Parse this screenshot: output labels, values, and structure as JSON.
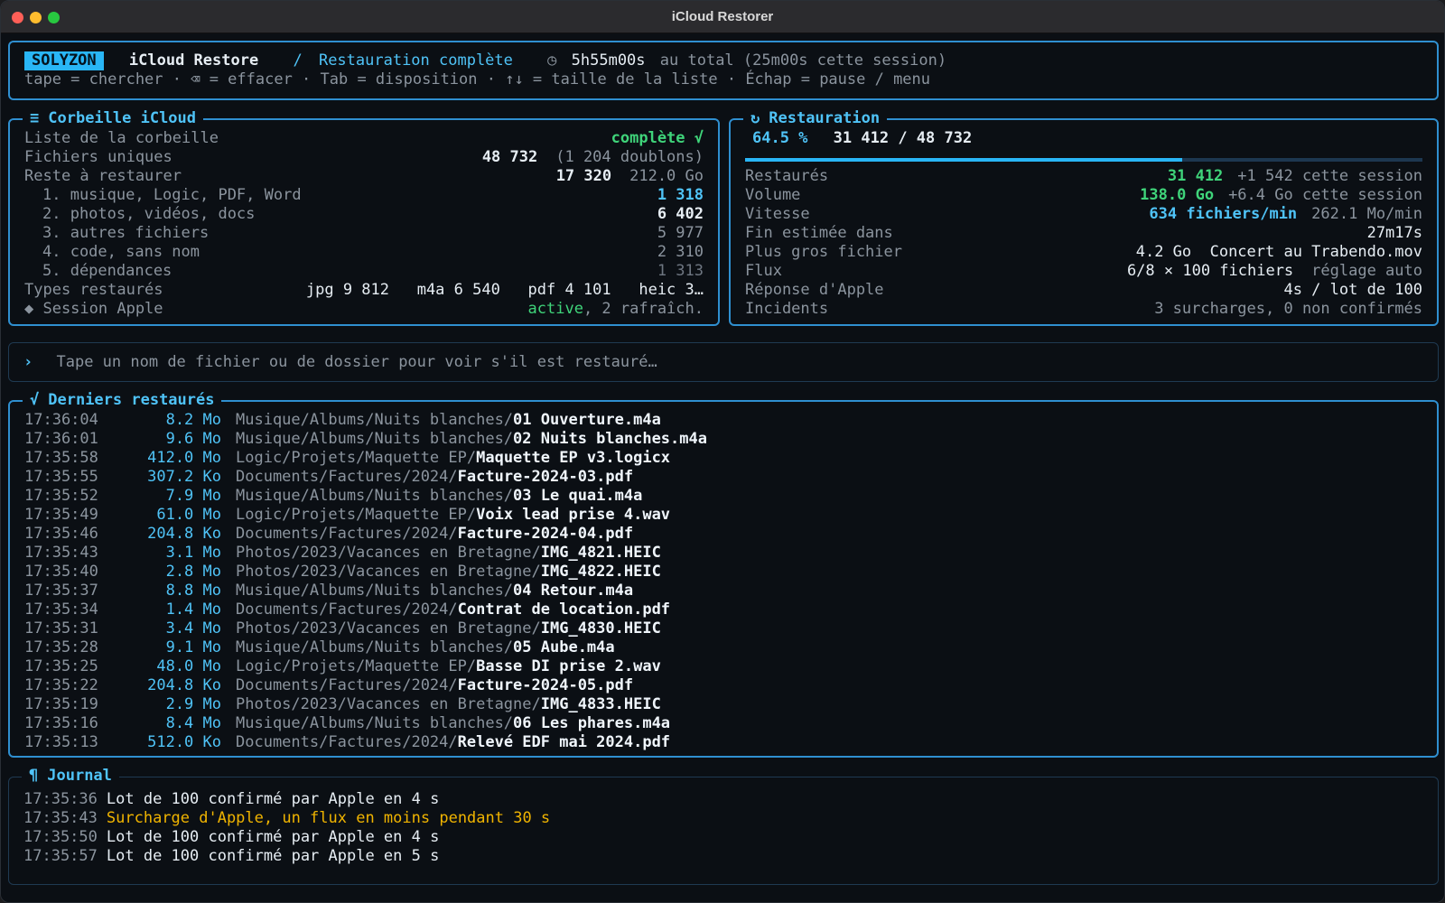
{
  "window": {
    "title": "iCloud Restorer"
  },
  "header": {
    "brand": "SOLYZON",
    "app": "iCloud Restore",
    "separator": "/",
    "mode": "Restauration complète",
    "clock_icon": "◷",
    "elapsed": "5h55m00s",
    "elapsed_suffix": "au total (25m00s cette session)",
    "hints": "tape = chercher · ⌫ = effacer · Tab = disposition · ↑↓ = taille de la liste · Échap = pause / menu"
  },
  "trash": {
    "title_icon": "≡",
    "title": "Corbeille iCloud",
    "rows": [
      {
        "label": "Liste de la corbeille",
        "value": "complète √"
      },
      {
        "label": "Fichiers uniques",
        "value": "48 732",
        "extra": "(1 204 doublons)"
      },
      {
        "label": "Reste à restaurer",
        "value": "17 320",
        "extra": "212.0 Go"
      },
      {
        "label": "1. musique, Logic, PDF, Word",
        "value": "1 318"
      },
      {
        "label": "2. photos, vidéos, docs",
        "value": "6 402"
      },
      {
        "label": "3. autres fichiers",
        "value": "5 977"
      },
      {
        "label": "4. code, sans nom",
        "value": "2 310"
      },
      {
        "label": "5. dépendances",
        "value": "1 313"
      },
      {
        "label": "Types restaurés",
        "value": "jpg 9 812   m4a 6 540   pdf 4 101   heic 3…"
      },
      {
        "label": "◆ Session Apple",
        "value_green": "active",
        "value_rest": ", 2 rafraîch."
      }
    ]
  },
  "restore": {
    "title_icon": "↻",
    "title": "Restauration",
    "percent": "64.5 %",
    "progress": 0.645,
    "count": "31 412 / 48 732",
    "rows": [
      {
        "label": "Restaurés",
        "value": "31 412",
        "extra": "+1 542 cette session"
      },
      {
        "label": "Volume",
        "value": "138.0 Go",
        "extra": "+6.4 Go cette session"
      },
      {
        "label": "Vitesse",
        "value": "634 fichiers/min",
        "extra": "262.1 Mo/min"
      },
      {
        "label": "Fin estimée dans",
        "value": "27m17s"
      },
      {
        "label": "Plus gros fichier",
        "value": "4.2 Go  Concert au Trabendo.mov"
      },
      {
        "label": "Flux",
        "value": "6/8 × 100 fichiers",
        "extra": "réglage auto"
      },
      {
        "label": "Réponse d'Apple",
        "value": "4s / lot de 100"
      },
      {
        "label": "Incidents",
        "value": "3 surcharges, 0 non confirmés"
      }
    ]
  },
  "search": {
    "prompt": "›",
    "placeholder": "Tape un nom de fichier ou de dossier pour voir s'il est restauré…"
  },
  "recent": {
    "title_icon": "√",
    "title": "Derniers restaurés",
    "items": [
      {
        "time": "17:36:04",
        "size": "8.2 Mo",
        "dir": "Musique/Albums/Nuits blanches/",
        "file": "01 Ouverture.m4a"
      },
      {
        "time": "17:36:01",
        "size": "9.6 Mo",
        "dir": "Musique/Albums/Nuits blanches/",
        "file": "02 Nuits blanches.m4a"
      },
      {
        "time": "17:35:58",
        "size": "412.0 Mo",
        "dir": "Logic/Projets/Maquette EP/",
        "file": "Maquette EP v3.logicx"
      },
      {
        "time": "17:35:55",
        "size": "307.2 Ko",
        "dir": "Documents/Factures/2024/",
        "file": "Facture-2024-03.pdf"
      },
      {
        "time": "17:35:52",
        "size": "7.9 Mo",
        "dir": "Musique/Albums/Nuits blanches/",
        "file": "03 Le quai.m4a"
      },
      {
        "time": "17:35:49",
        "size": "61.0 Mo",
        "dir": "Logic/Projets/Maquette EP/",
        "file": "Voix lead prise 4.wav"
      },
      {
        "time": "17:35:46",
        "size": "204.8 Ko",
        "dir": "Documents/Factures/2024/",
        "file": "Facture-2024-04.pdf"
      },
      {
        "time": "17:35:43",
        "size": "3.1 Mo",
        "dir": "Photos/2023/Vacances en Bretagne/",
        "file": "IMG_4821.HEIC"
      },
      {
        "time": "17:35:40",
        "size": "2.8 Mo",
        "dir": "Photos/2023/Vacances en Bretagne/",
        "file": "IMG_4822.HEIC"
      },
      {
        "time": "17:35:37",
        "size": "8.8 Mo",
        "dir": "Musique/Albums/Nuits blanches/",
        "file": "04 Retour.m4a"
      },
      {
        "time": "17:35:34",
        "size": "1.4 Mo",
        "dir": "Documents/Factures/2024/",
        "file": "Contrat de location.pdf"
      },
      {
        "time": "17:35:31",
        "size": "3.4 Mo",
        "dir": "Photos/2023/Vacances en Bretagne/",
        "file": "IMG_4830.HEIC"
      },
      {
        "time": "17:35:28",
        "size": "9.1 Mo",
        "dir": "Musique/Albums/Nuits blanches/",
        "file": "05 Aube.m4a"
      },
      {
        "time": "17:35:25",
        "size": "48.0 Mo",
        "dir": "Logic/Projets/Maquette EP/",
        "file": "Basse DI prise 2.wav"
      },
      {
        "time": "17:35:22",
        "size": "204.8 Ko",
        "dir": "Documents/Factures/2024/",
        "file": "Facture-2024-05.pdf"
      },
      {
        "time": "17:35:19",
        "size": "2.9 Mo",
        "dir": "Photos/2023/Vacances en Bretagne/",
        "file": "IMG_4833.HEIC"
      },
      {
        "time": "17:35:16",
        "size": "8.4 Mo",
        "dir": "Musique/Albums/Nuits blanches/",
        "file": "06 Les phares.m4a"
      },
      {
        "time": "17:35:13",
        "size": "512.0 Ko",
        "dir": "Documents/Factures/2024/",
        "file": "Relevé EDF mai 2024.pdf"
      }
    ]
  },
  "journal": {
    "title_icon": "¶",
    "title": "Journal",
    "entries": [
      {
        "time": "17:35:36",
        "text": "Lot de 100 confirmé par Apple en 4 s",
        "level": "info"
      },
      {
        "time": "17:35:43",
        "text": "Surcharge d'Apple, un flux en moins pendant 30 s",
        "level": "warn"
      },
      {
        "time": "17:35:50",
        "text": "Lot de 100 confirmé par Apple en 4 s",
        "level": "info"
      },
      {
        "time": "17:35:57",
        "text": "Lot de 100 confirmé par Apple en 5 s",
        "level": "info"
      }
    ]
  },
  "colors": {
    "accent": "#4fc3f7",
    "border": "#2f8fd0",
    "ok": "#3fd47a",
    "warn": "#f0b400",
    "background": "#0b0f14"
  }
}
